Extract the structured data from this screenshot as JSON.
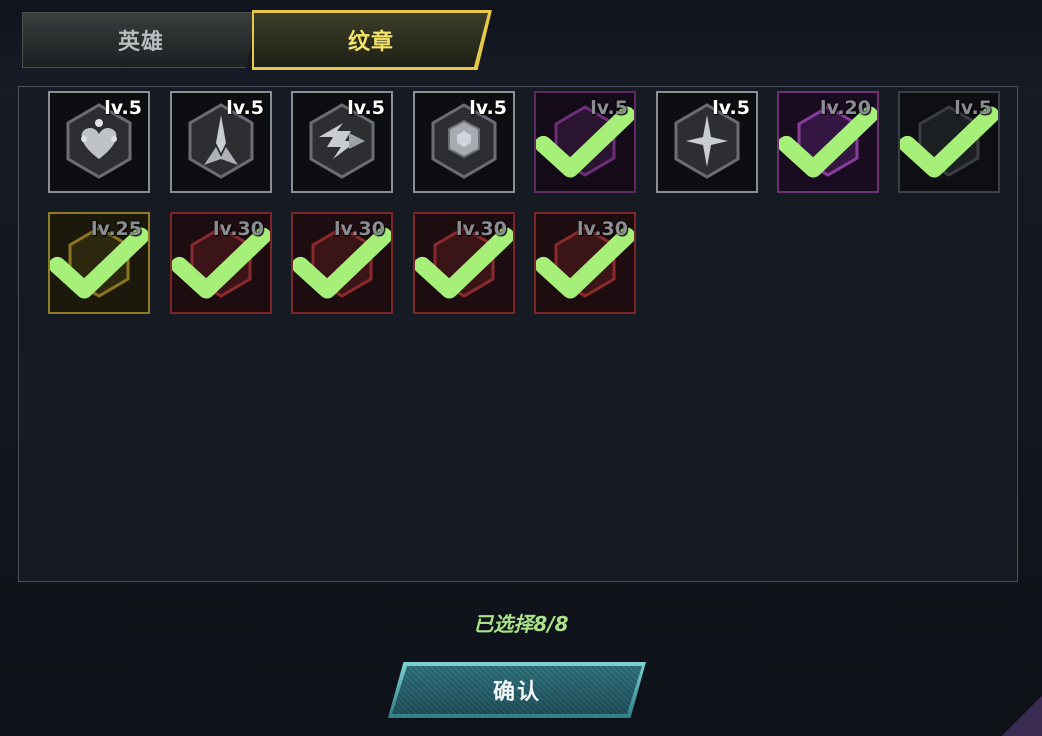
{
  "tabs": [
    {
      "label": "英雄",
      "active": false
    },
    {
      "label": "纹章",
      "active": true
    }
  ],
  "emblems": [
    {
      "level": "lv.5",
      "icon": "heart-orbit-icon",
      "selected": false,
      "style": "silver"
    },
    {
      "level": "lv.5",
      "icon": "burst-spike-icon",
      "selected": false,
      "style": "silver"
    },
    {
      "level": "lv.5",
      "icon": "lightning-arrow-icon",
      "selected": false,
      "style": "silver"
    },
    {
      "level": "lv.5",
      "icon": "turtle-shell-icon",
      "selected": false,
      "style": "silver"
    },
    {
      "level": "lv.5",
      "icon": "check-icon",
      "selected": true,
      "style": "purple"
    },
    {
      "level": "lv.5",
      "icon": "star-burst-icon",
      "selected": false,
      "style": "silver"
    },
    {
      "level": "lv.20",
      "icon": "check-icon",
      "selected": true,
      "style": "purple2"
    },
    {
      "level": "lv.5",
      "icon": "check-icon",
      "selected": true,
      "style": "dark"
    },
    {
      "level": "lv.25",
      "icon": "check-icon",
      "selected": true,
      "style": "gold"
    },
    {
      "level": "lv.30",
      "icon": "check-icon",
      "selected": true,
      "style": "red"
    },
    {
      "level": "lv.30",
      "icon": "check-icon",
      "selected": true,
      "style": "red"
    },
    {
      "level": "lv.30",
      "icon": "check-icon",
      "selected": true,
      "style": "red"
    },
    {
      "level": "lv.30",
      "icon": "check-icon",
      "selected": true,
      "style": "red"
    }
  ],
  "status": {
    "text": "已选择8/8"
  },
  "confirm": {
    "label": "确认"
  },
  "colors": {
    "accent_gold": "#e7c84a",
    "check_green": "#a6f07a",
    "status_green": "#a9e28a",
    "confirm_teal": "#2a6d78"
  }
}
